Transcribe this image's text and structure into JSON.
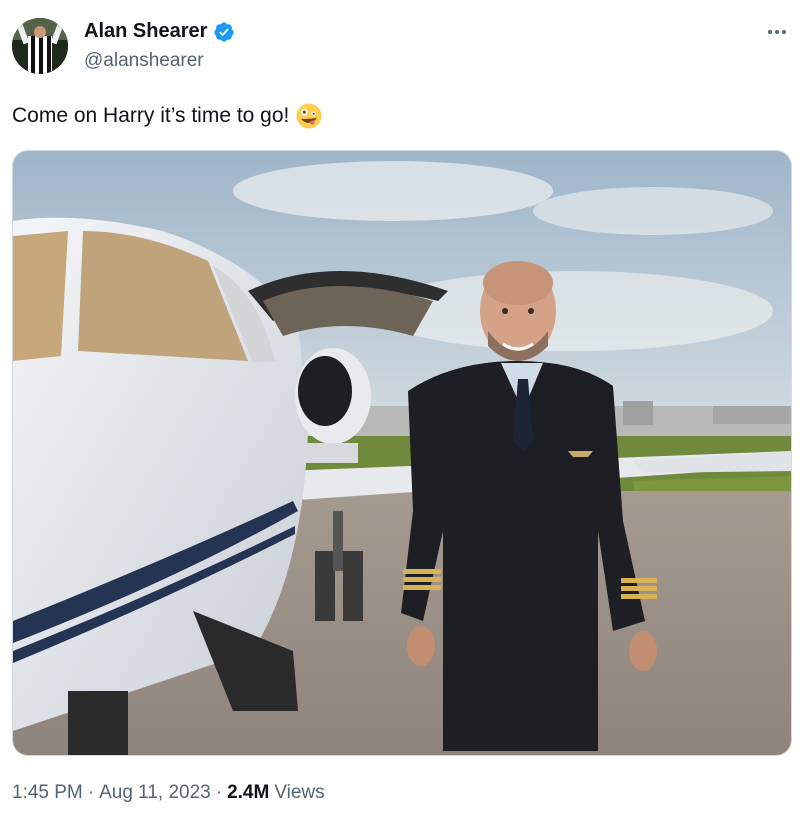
{
  "author": {
    "display_name": "Alan Shearer",
    "handle": "@alanshearer",
    "verified": true,
    "verified_color": "#1d9bf0"
  },
  "tweet": {
    "text": "Come on Harry it’s time to go!",
    "emoji": "zany-face-emoji"
  },
  "media": {
    "description_icon": "photo"
  },
  "meta": {
    "time": "1:45 PM",
    "separator": "·",
    "date": "Aug 11, 2023",
    "views_count": "2.4M",
    "views_label": "Views"
  },
  "colors": {
    "text_primary": "#0f1419",
    "text_secondary": "#536471",
    "border": "#cfd9de"
  }
}
